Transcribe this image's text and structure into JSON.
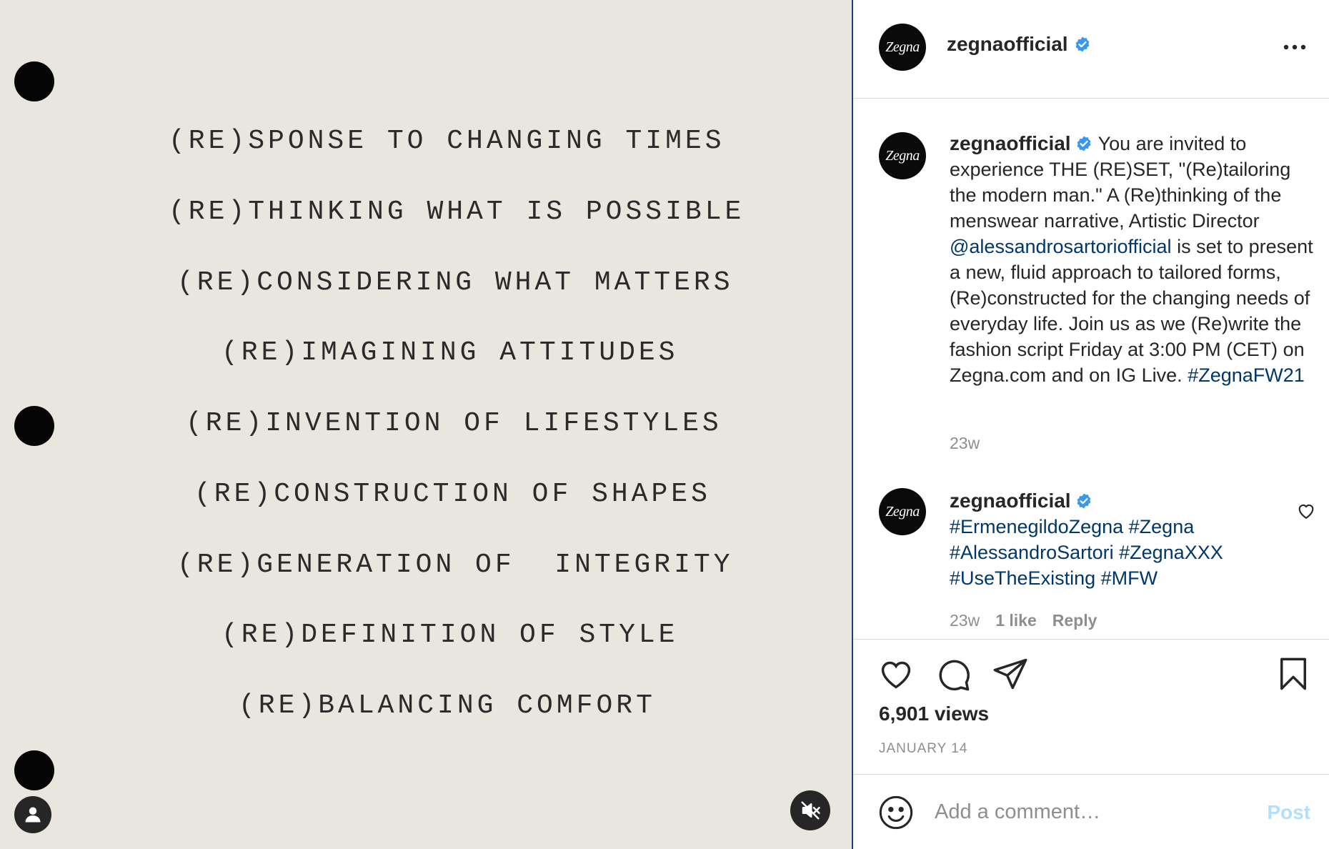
{
  "media": {
    "typed_lines": [
      "(RE)SPONSE TO CHANGING TIMES",
      "(RE)THINKING WHAT IS POSSIBLE",
      "(RE)CONSIDERING WHAT MATTERS",
      "(RE)IMAGINING ATTITUDES",
      "(RE)INVENTION OF LIFESTYLES",
      "(RE)CONSTRUCTION OF SHAPES",
      "(RE)GENERATION OF  INTEGRITY",
      "(RE)DEFINITION OF STYLE",
      "(RE)BALANCING COMFORT"
    ],
    "mute_icon": "speaker-muted-icon",
    "user_tag_icon": "user-icon"
  },
  "header": {
    "avatar_text": "Zegna",
    "username": "zegnaofficial",
    "verified_icon": "verified-badge-icon",
    "more_icon": "more-dots-icon"
  },
  "caption": {
    "username": "zegnaofficial",
    "text_1": "You are invited to experience THE (RE)SET, \"(Re)tailoring the modern man.\" A (Re)thinking of the menswear narrative, Artistic Director ",
    "mention": "@alessandrosartoriofficial",
    "text_2": " is set to present a new, fluid approach to tailored forms, (Re)constructed for the changing needs of everyday life. Join us as we (Re)write the fashion script Friday at 3:00 PM (CET) on Zegna.com and on IG Live. ",
    "hashtag": "#ZegnaFW21",
    "time": "23w"
  },
  "comment": {
    "username": "zegnaofficial",
    "hashtags_line1": "#ErmenegildoZegna #Zegna",
    "hashtags_line2": "#AlessandroSartori #ZegnaXXX",
    "hashtags_line3": "#UseTheExisting #MFW",
    "time": "23w",
    "likes": "1 like",
    "reply": "Reply"
  },
  "actions": {
    "views": "6,901 views",
    "date": "JANUARY 14"
  },
  "add_comment": {
    "placeholder": "Add a comment…",
    "post_label": "Post"
  },
  "colors": {
    "media_bg": "#e9e6e0",
    "link": "#00376b",
    "verified": "#3897f0",
    "post_disabled": "#b2dffc"
  }
}
